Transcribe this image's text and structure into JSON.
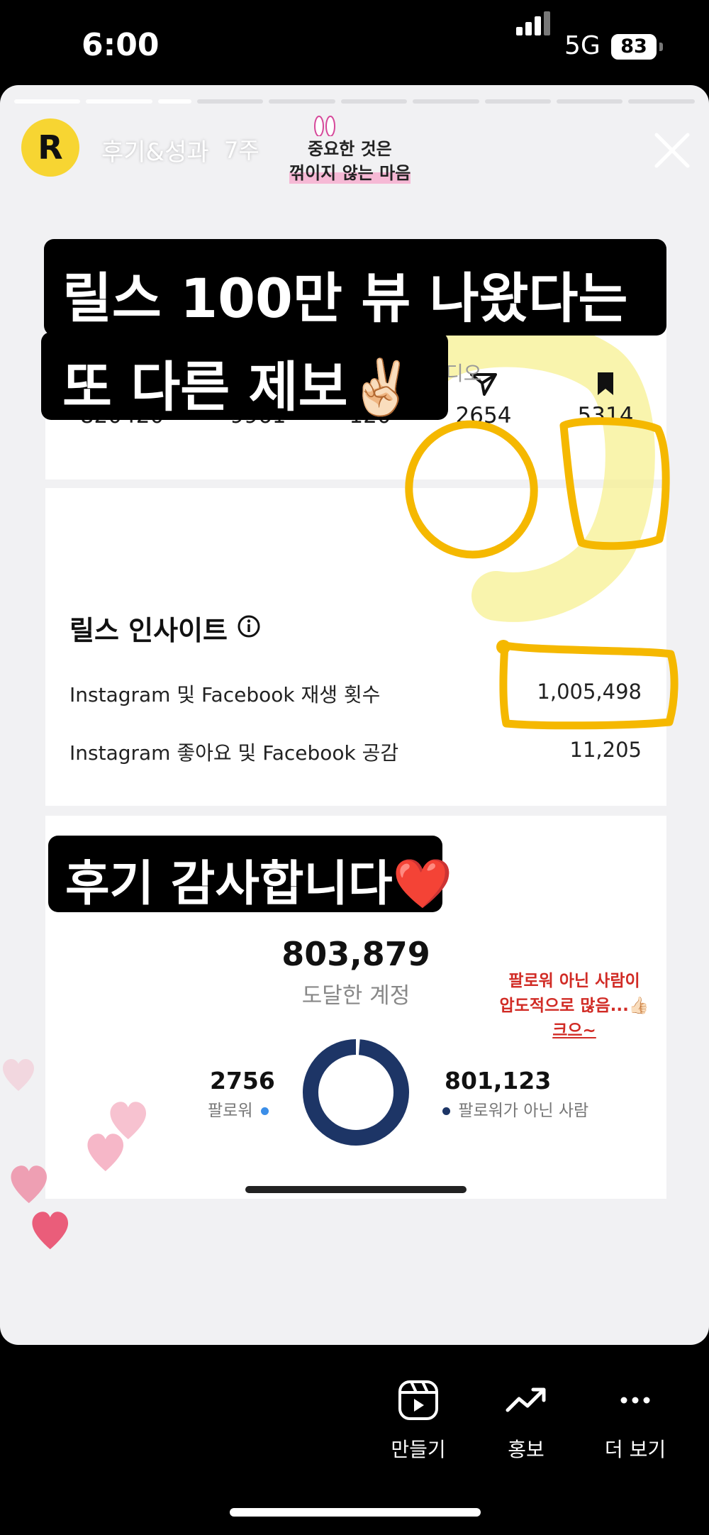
{
  "status_bar": {
    "time": "6:00",
    "network": "5G",
    "battery": "83"
  },
  "story": {
    "username": "후기&성과",
    "age": "7주",
    "sticker": {
      "line1": "중요한 것은",
      "line2": "꺾이지 않는 마음"
    }
  },
  "overlay_text": {
    "headline_line1": "릴스 100만 뷰 나왔다는",
    "headline_line2": "또 다른 제보✌🏻",
    "thanks": "후기 감사합니다❤️",
    "peek_text": "디오",
    "note_line1": "팔로워 아닌 사람이",
    "note_line2": "압도적으로 많음...👍🏻",
    "note_line3": "크으~"
  },
  "reel_stats": [
    {
      "icon": "play-icon",
      "value": "820420"
    },
    {
      "icon": "heart-icon",
      "value": "9961"
    },
    {
      "icon": "comment-icon",
      "value": "120"
    },
    {
      "icon": "share-icon",
      "value": "2654"
    },
    {
      "icon": "bookmark-icon",
      "value": "5314"
    }
  ],
  "insights": {
    "title": "릴스 인사이트",
    "rows": [
      {
        "label": "Instagram 및 Facebook 재생 횟수",
        "value": "1,005,498"
      },
      {
        "label": "Instagram 좋아요 및 Facebook 공감",
        "value": "11,205"
      }
    ]
  },
  "reach": {
    "total": "803,879",
    "label": "도달한 계정",
    "followers_value": "2756",
    "followers_label": "팔로워",
    "non_followers_value": "801,123",
    "non_followers_label": "팔로워가 아닌 사람",
    "followers_fraction": 0.0034
  },
  "bottom_actions": [
    {
      "icon": "reels-create-icon",
      "label": "만들기"
    },
    {
      "icon": "trend-icon",
      "label": "홍보"
    },
    {
      "icon": "more-icon",
      "label": "더 보기"
    }
  ],
  "colors": {
    "highlight_yellow": "#f5b800",
    "note_red": "#d12b25",
    "donut_navy": "#1d3566",
    "follower_blue": "#3b8ee8",
    "avatar_yellow": "#f7d532"
  }
}
